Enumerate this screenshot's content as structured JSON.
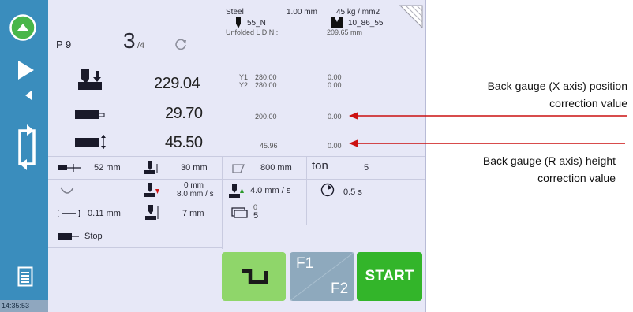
{
  "clock": "14:35:53",
  "header": {
    "program": "P 9",
    "step_current": "3",
    "step_total": "/4",
    "material": "Steel",
    "thickness": "1.00 mm",
    "strength": "45 kg / mm2",
    "punch": "55_N",
    "unfolded_label": "Unfolded L DIN :",
    "die": "10_86_55",
    "unfolded_value": "209.65 mm"
  },
  "axes": {
    "y_value": "229.04",
    "y1_label": "Y1",
    "y1_value": "280.00",
    "y2_label": "Y2",
    "y2_value": "280.00",
    "y1_corr": "0.00",
    "y2_corr": "0.00",
    "x_value": "29.70",
    "x_ref": "200.00",
    "x_corr": "0.00",
    "r_value": "45.50",
    "r_ref": "45.96",
    "r_corr": "0.00"
  },
  "params": {
    "opening": "52 mm",
    "mute": "30 mm",
    "force_dist": "800 mm",
    "ton_label": "ton",
    "ton_value": "5",
    "speed_dist": "0 mm",
    "speed": "8.0 mm / s",
    "return_speed": "4.0 mm / s",
    "dwell": "0.5 s",
    "crowning": "0.11 mm",
    "retract": "7 mm",
    "stack_top": "0",
    "stack_bottom": "5",
    "stop_label": "Stop"
  },
  "buttons": {
    "f1": "F1",
    "f2": "F2",
    "start": "START"
  },
  "annotations": {
    "x_axis_line1": "Back gauge (X axis) position",
    "x_axis_line2": "correction value",
    "r_axis_line1": "Back gauge (R axis) height",
    "r_axis_line2": "correction value"
  },
  "colors": {
    "sidebar": "#3a8dbd",
    "panel": "#e7e8f7",
    "start_button": "#33b52a",
    "shape_button": "#8fd66a",
    "function_button": "#8ea9bd",
    "arrow": "#cc1111"
  }
}
